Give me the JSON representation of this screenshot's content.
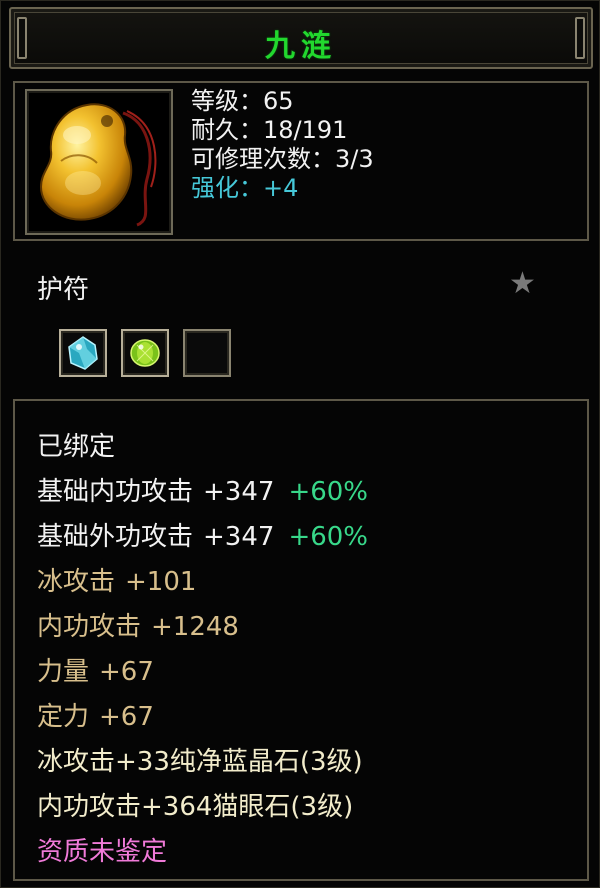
{
  "item": {
    "name": "九涟",
    "image_icon": "amber-jade-pendant-icon",
    "stats": {
      "level": "等级：65",
      "durability": "耐久：18/191",
      "repairs": "可修理次数：3/3",
      "enhance": "强化：+4"
    },
    "type": "护符",
    "favorite_icon": "star-icon",
    "sockets": [
      {
        "icon": "blue-crystal-gem-icon",
        "color": "#4ad0d8"
      },
      {
        "icon": "green-cats-eye-gem-icon",
        "color": "#9ad832"
      },
      {
        "icon": "empty-socket-icon",
        "color": "#111111"
      }
    ]
  },
  "attributes": {
    "bound": "已绑定",
    "base_inner_attack": {
      "label": "基础内功攻击",
      "value": "+347",
      "bonus": "+60%"
    },
    "base_outer_attack": {
      "label": "基础外功攻击",
      "value": "+347",
      "bonus": "+60%"
    },
    "ice_attack": {
      "label": "冰攻击",
      "value": "+101"
    },
    "inner_attack": {
      "label": "内功攻击",
      "value": "+1248"
    },
    "strength": {
      "label": "力量",
      "value": "+67"
    },
    "focus": {
      "label": "定力",
      "value": "+67"
    },
    "gem1": "冰攻击+33纯净蓝晶石(3级)",
    "gem2": "内功攻击+364猫眼石(3级)",
    "quality": "资质未鉴定"
  },
  "colors": {
    "title": "#22d82e",
    "enhance": "#46c8d8",
    "bonus": "#38d88a",
    "attr_tan": "#d8bf8c",
    "gem_text": "#f2eccb",
    "quality": "#f07ad8"
  }
}
